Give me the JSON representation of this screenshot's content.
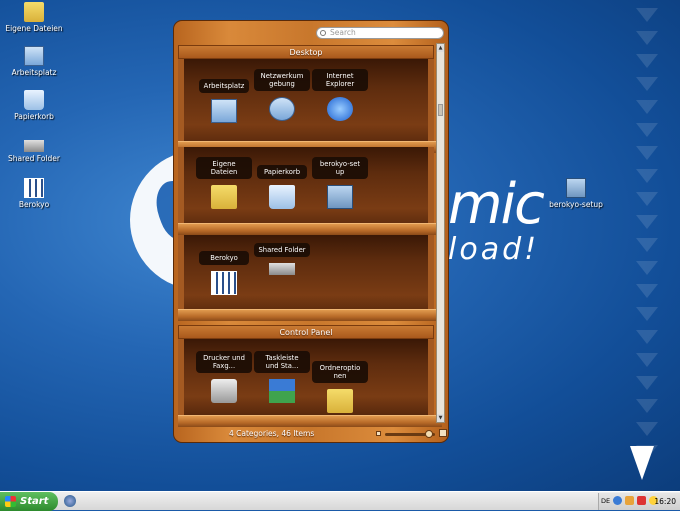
{
  "desktop": {
    "icons": [
      {
        "label": "Eigene Dateien",
        "icon": "folder-icon"
      },
      {
        "label": "Arbeitsplatz",
        "icon": "computer-icon"
      },
      {
        "label": "Papierkorb",
        "icon": "recycle-bin-icon"
      },
      {
        "label": "Shared Folder",
        "icon": "network-drive-icon"
      },
      {
        "label": "Berokyo",
        "icon": "berokyo-icon"
      },
      {
        "label": "berokyo-setup",
        "icon": "setup-icon"
      }
    ],
    "wallpaper_text": {
      "line1": "mic",
      "line2": "load!"
    }
  },
  "berokyo": {
    "search_placeholder": "Search",
    "categories": [
      {
        "title": "Desktop",
        "rows": [
          [
            {
              "label": "Arbeitsplatz",
              "icon": "computer-icon"
            },
            {
              "label": "Netzwerkum gebung",
              "icon": "network-icon"
            },
            {
              "label": "Internet Explorer",
              "icon": "internet-explorer-icon"
            }
          ],
          [
            {
              "label": "Eigene Dateien",
              "icon": "folder-icon"
            },
            {
              "label": "Papierkorb",
              "icon": "recycle-bin-icon"
            },
            {
              "label": "berokyo-set up",
              "icon": "setup-icon"
            }
          ],
          [
            {
              "label": "Berokyo",
              "icon": "berokyo-icon"
            },
            {
              "label": "Shared Folder",
              "icon": "network-drive-icon"
            }
          ]
        ]
      },
      {
        "title": "Control Panel",
        "rows": [
          [
            {
              "label": "Drucker und Faxg...",
              "icon": "printer-icon"
            },
            {
              "label": "Taskleiste und Sta...",
              "icon": "taskbar-icon"
            },
            {
              "label": "Ordneroptio nen",
              "icon": "folder-options-icon"
            }
          ]
        ]
      }
    ],
    "status": "4 Categories, 46 Items",
    "zoom_level": 0.9
  },
  "taskbar": {
    "start_label": "Start",
    "language": "DE",
    "clock": "16:20"
  },
  "colors": {
    "wood_light": "#dc8c3c",
    "wood_dark": "#5e2c0e",
    "desktop_blue": "#2466b4",
    "start_green": "#2d8a2d"
  }
}
